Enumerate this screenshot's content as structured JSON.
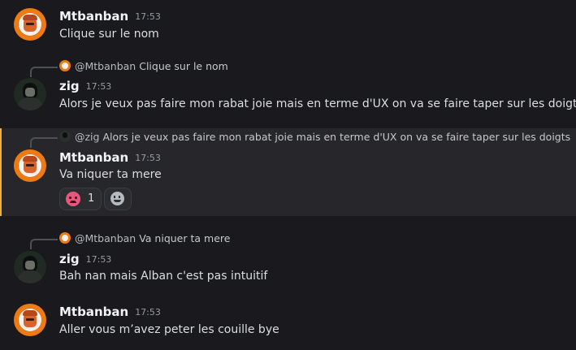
{
  "messages": [
    {
      "author": "Mtbanban",
      "time": "17:53",
      "text": "Clique sur le nom",
      "avatar": "orange-pokeball-avatar"
    },
    {
      "reply_to": {
        "author": "@Mtbanban",
        "text": "Clique sur le nom"
      },
      "author": "zig",
      "time": "17:53",
      "text": "Alors je veux pas faire mon rabat joie mais en terme d'UX on va se faire taper sur les doigts",
      "avatar": "dark-character-avatar"
    },
    {
      "reply_to": {
        "author": "@zig",
        "text": "Alors je veux pas faire mon rabat joie mais en terme d'UX on va se faire taper sur les doigts"
      },
      "author": "Mtbanban",
      "time": "17:53",
      "text": "Va niquer ta mere",
      "avatar": "orange-pokeball-avatar",
      "highlighted": true,
      "reactions": [
        {
          "emoji": "angry-face-emoji",
          "count": "1"
        }
      ]
    },
    {
      "reply_to": {
        "author": "@Mtbanban",
        "text": "Va niquer ta mere"
      },
      "author": "zig",
      "time": "17:53",
      "text": "Bah nan mais Alban c'est pas intuitif",
      "avatar": "dark-character-avatar"
    },
    {
      "author": "Mtbanban",
      "time": "17:53",
      "text": "Aller vous m’avez peter les couille bye",
      "avatar": "orange-pokeball-avatar"
    }
  ],
  "colors": {
    "background": "#1a1a1e",
    "highlight_bar": "#f0b232",
    "highlight_bg": "#26262b",
    "username": "#f2f3f5",
    "timestamp": "#949ba4"
  }
}
